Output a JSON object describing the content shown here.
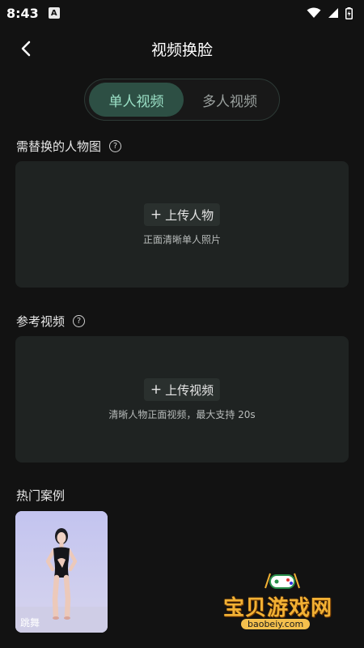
{
  "status_bar": {
    "time": "8:43",
    "app_icon": "A"
  },
  "nav": {
    "title": "视频换脸"
  },
  "tabs": [
    {
      "label": "单人视频",
      "active": true
    },
    {
      "label": "多人视频",
      "active": false
    }
  ],
  "person_section": {
    "label": "需替换的人物图",
    "upload_label": "上传人物",
    "hint": "正面清晰单人照片"
  },
  "video_section": {
    "label": "参考视频",
    "upload_label": "上传视频",
    "hint": "清晰人物正面视频，最大支持 20s"
  },
  "hot_cases": {
    "label": "热门案例",
    "items": [
      {
        "label": "跳舞"
      }
    ]
  },
  "watermark": {
    "brand": "宝贝游戏网",
    "url": "baobeiy.com"
  },
  "colors": {
    "background": "#121212",
    "card": "#1f2322",
    "tab_active_bg": "#2d4f44",
    "tab_active_text": "#9be0c6",
    "tab_inactive_text": "#9aa09e"
  }
}
